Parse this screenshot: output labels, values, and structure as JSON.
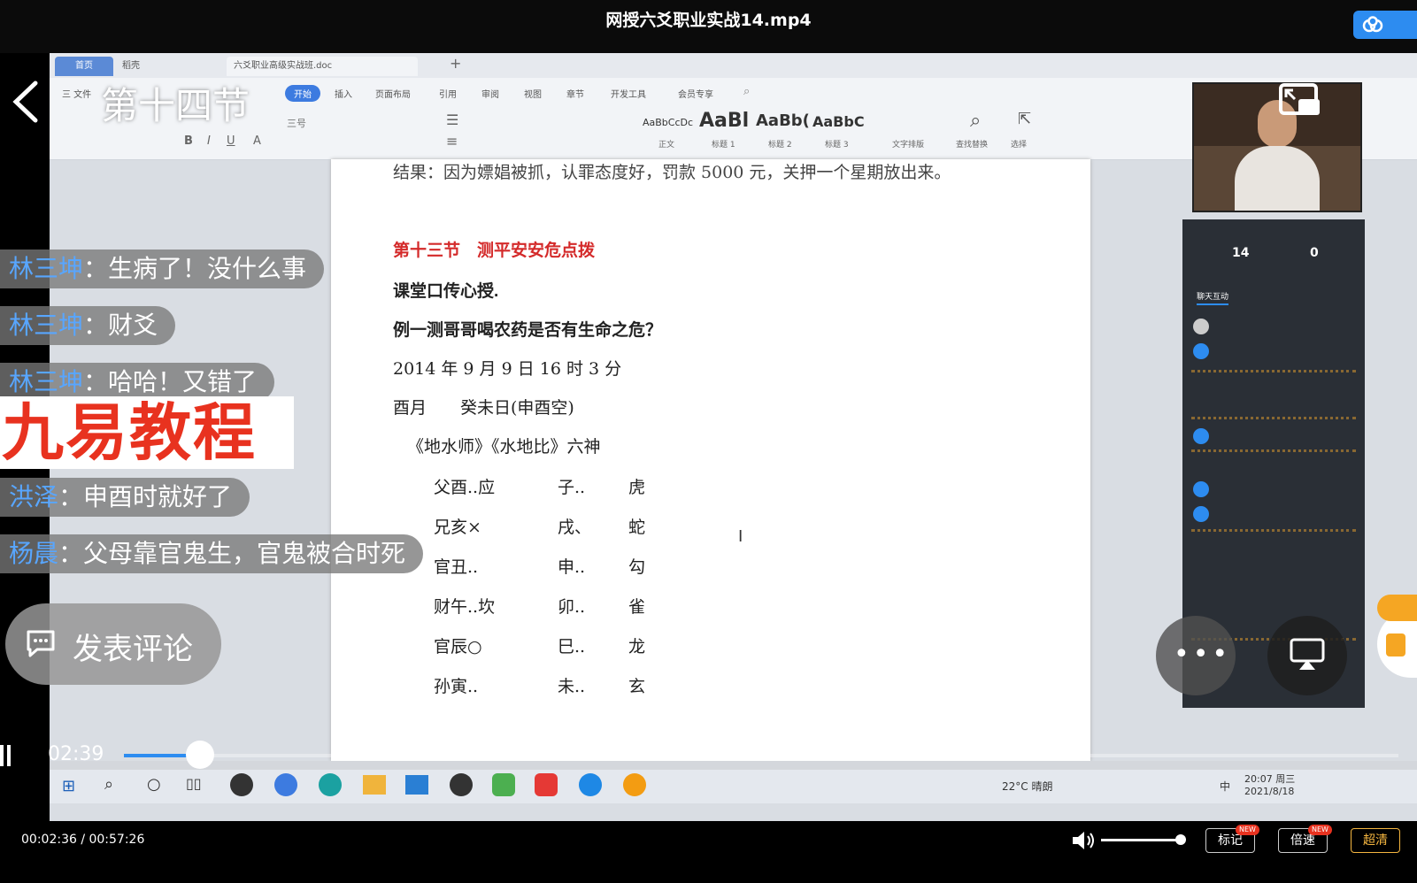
{
  "player": {
    "title": "网授六爻职业实战14.mp4",
    "lesson_title": "第十四节",
    "position_time": "02:39",
    "time_readout": "00:02:36 / 00:57:26",
    "progress_fraction": 0.045,
    "volume_fraction": 0.85,
    "buttons": {
      "mark": "标记",
      "speed": "倍速",
      "quality": "超清",
      "new_badge": "NEW",
      "comment": "发表评论"
    },
    "watermark": "九易教程",
    "colors": {
      "accent": "#2d8cf0",
      "watermark": "#e8321f",
      "username": "#58a6ff",
      "quality": "#f5b640"
    }
  },
  "danmu": [
    {
      "user": "林三坤",
      "text": "生病了！没什么事"
    },
    {
      "user": "林三坤",
      "text": "财爻"
    },
    {
      "user": "林三坤",
      "text": "哈哈！又错了"
    },
    {
      "user": "洪泽",
      "text": "申酉时就好了"
    },
    {
      "user": "杨晨",
      "text": "父母靠官鬼生，官鬼被合时死"
    }
  ],
  "wps": {
    "tabs": [
      "首页",
      "稻壳",
      "六爻职业高级实战班.doc"
    ],
    "menus": [
      "三 文件",
      "开始",
      "插入",
      "页面布局",
      "引用",
      "审阅",
      "视图",
      "章节",
      "开发工具",
      "会员专享"
    ],
    "styles": [
      "AaBbCcDc",
      "AaBl",
      "AaBb(",
      "AaBbC"
    ],
    "style_names": [
      "正文",
      "标题 1",
      "标题 2",
      "标题 3"
    ],
    "font_size": "三号",
    "tools": [
      "文字排版",
      "查找替换",
      "选择"
    ],
    "clock": {
      "temp": "22°C 晴朗",
      "time": "20:07 周三",
      "date": "2021/8/18",
      "ime": "中"
    }
  },
  "document": {
    "prev_result": "结果：因为嫖娼被抓，认罪态度好，罚款 5000 元，关押一个星期放出来。",
    "section_title": "第十三节　测平安安危点拨",
    "subtitle": "课堂口传心授.",
    "example": "例一测哥哥喝农药是否有生命之危？",
    "date": "2014 年 9 月 9 日 16 时 3 分",
    "month_day": "酉月　　癸未日(申酉空)",
    "gua": "《地水师》《水地比》六神",
    "rows": [
      [
        "父酉..应",
        "子..",
        "虎"
      ],
      [
        "兄亥×",
        "戌、",
        "蛇"
      ],
      [
        "官丑..",
        "申..",
        "勾"
      ],
      [
        "财午..坎",
        "卯..",
        "雀"
      ],
      [
        "官辰○",
        "巳..",
        "龙"
      ],
      [
        "孙寅..",
        "未..",
        "玄"
      ]
    ]
  },
  "live_panel": {
    "stat1_value": "14",
    "stat2_value": "0",
    "tab": "聊天互动"
  }
}
